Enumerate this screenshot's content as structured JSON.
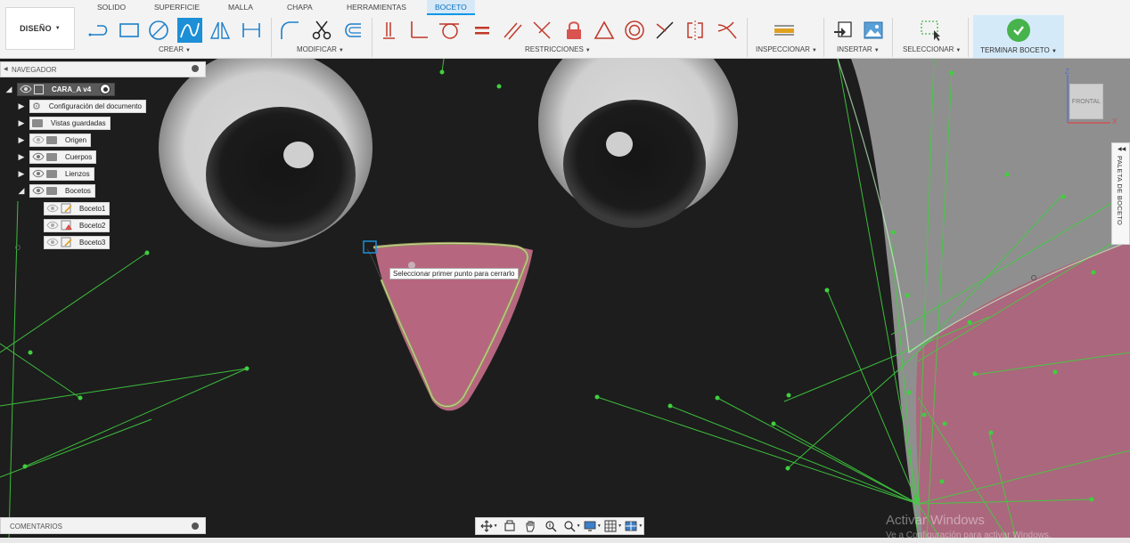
{
  "workspace": {
    "label": "DISEÑO"
  },
  "tabs": [
    {
      "label": "SOLIDO",
      "active": false
    },
    {
      "label": "SUPERFICIE",
      "active": false
    },
    {
      "label": "MALLA",
      "active": false
    },
    {
      "label": "CHAPA",
      "active": false
    },
    {
      "label": "HERRAMIENTAS",
      "active": false
    },
    {
      "label": "BOCETO",
      "active": true
    }
  ],
  "groups": {
    "crear": "CREAR",
    "modificar": "MODIFICAR",
    "restricciones": "RESTRICCIONES",
    "inspeccionar": "INSPECCIONAR",
    "insertar": "INSERTAR",
    "seleccionar": "SELECCIONAR",
    "terminar": "TERMINAR BOCETO"
  },
  "colors": {
    "accent": "#0a96e6",
    "active_tool": "#1c8fd6",
    "finish_bg": "#d5eaf9",
    "finish_check": "#47b34c",
    "constraint_red": "#c0392b",
    "sketch_green": "#3fcf3f",
    "canvas_bg": "#1c1c1c"
  },
  "navigator": {
    "title": "NAVEGADOR",
    "root": {
      "label": "CARA_A v4"
    },
    "items": [
      {
        "label": "Configuración del documento",
        "icon": "gear-icon",
        "toggle": "▶"
      },
      {
        "label": "Vistas guardadas",
        "icon": "folder-icon",
        "toggle": "▶"
      },
      {
        "label": "Origen",
        "icon": "folder-icon",
        "toggle": "▶"
      },
      {
        "label": "Cuerpos",
        "icon": "folder-icon",
        "toggle": "▶"
      },
      {
        "label": "Lienzos",
        "icon": "folder-icon",
        "toggle": "▶"
      },
      {
        "label": "Bocetos",
        "icon": "folder-icon",
        "toggle": "◢"
      }
    ],
    "sketches": [
      {
        "label": "Boceto1",
        "icon": "sketch-icon"
      },
      {
        "label": "Boceto2",
        "icon": "sketch-error-icon"
      },
      {
        "label": "Boceto3",
        "icon": "sketch-icon"
      }
    ]
  },
  "comments": {
    "title": "COMENTARIOS"
  },
  "tooltip": {
    "text": "Seleccionar primer punto para cerrarlo"
  },
  "viewcube": {
    "face": "FRONTAL",
    "axis_z": "Z",
    "axis_x": "X"
  },
  "palette": {
    "label": "PALETA DE BOCETO"
  },
  "watermark": {
    "title": "Activar Windows",
    "subtitle": "Ve a Configuración para activar Windows."
  }
}
